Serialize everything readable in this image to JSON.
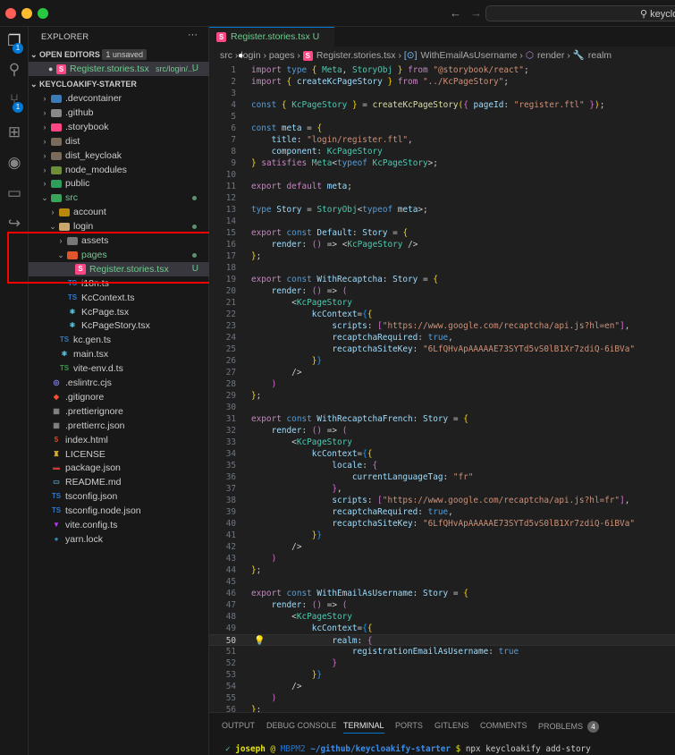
{
  "window": {
    "traffic_lights": [
      "#ff5f57",
      "#febc2e",
      "#28c840"
    ],
    "nav_back": "←",
    "nav_forward": "→",
    "search_text": "keyclo"
  },
  "activity": {
    "explorer_badge": "1",
    "scm_badge": "1"
  },
  "sidebar": {
    "title": "EXPLORER",
    "more": "···",
    "open_editors": {
      "label": "OPEN EDITORS",
      "badge": "1 unsaved",
      "file": "Register.stories.tsx",
      "path": "src/login/...",
      "status": "U"
    },
    "project": "KEYCLOAKIFY-STARTER",
    "tree": [
      {
        "name": ".devcontainer",
        "depth": 1,
        "type": "folder",
        "icon": "#3d7ab8"
      },
      {
        "name": ".github",
        "depth": 1,
        "type": "folder",
        "icon": "#888"
      },
      {
        "name": ".storybook",
        "depth": 1,
        "type": "folder",
        "icon": "#ff4785"
      },
      {
        "name": "dist",
        "depth": 1,
        "type": "folder",
        "icon": "#7a6b5a"
      },
      {
        "name": "dist_keycloak",
        "depth": 1,
        "type": "folder",
        "icon": "#7a6b5a"
      },
      {
        "name": "node_modules",
        "depth": 1,
        "type": "folder",
        "icon": "#6d8f3a"
      },
      {
        "name": "public",
        "depth": 1,
        "type": "folder",
        "icon": "#2e9e5a"
      },
      {
        "name": "src",
        "depth": 1,
        "type": "folder",
        "open": true,
        "icon": "#3aa55a",
        "green": true,
        "dot": true
      },
      {
        "name": "account",
        "depth": 2,
        "type": "folder",
        "icon": "#b8860b"
      },
      {
        "name": "login",
        "depth": 2,
        "type": "folder",
        "open": true,
        "icon": "#c9a66b",
        "dot": true
      },
      {
        "name": "assets",
        "depth": 3,
        "type": "folder",
        "icon": "#777"
      },
      {
        "name": "pages",
        "depth": 3,
        "type": "folder",
        "open": true,
        "icon": "#e0552b",
        "green": true,
        "dot": true
      },
      {
        "name": "Register.stories.tsx",
        "depth": 4,
        "type": "storybook",
        "selected": true,
        "green": true,
        "status": "U"
      },
      {
        "name": "i18n.ts",
        "depth": 3,
        "type": "ts"
      },
      {
        "name": "KcContext.ts",
        "depth": 3,
        "type": "ts"
      },
      {
        "name": "KcPage.tsx",
        "depth": 3,
        "type": "react"
      },
      {
        "name": "KcPageStory.tsx",
        "depth": 3,
        "type": "react"
      },
      {
        "name": "kc.gen.ts",
        "depth": 2,
        "type": "ts"
      },
      {
        "name": "main.tsx",
        "depth": 2,
        "type": "react"
      },
      {
        "name": "vite-env.d.ts",
        "depth": 2,
        "type": "tsd"
      },
      {
        "name": ".eslintrc.cjs",
        "depth": 1,
        "type": "eslint"
      },
      {
        "name": ".gitignore",
        "depth": 1,
        "type": "git"
      },
      {
        "name": ".prettierignore",
        "depth": 1,
        "type": "prettier"
      },
      {
        "name": ".prettierrc.json",
        "depth": 1,
        "type": "prettier"
      },
      {
        "name": "index.html",
        "depth": 1,
        "type": "html"
      },
      {
        "name": "LICENSE",
        "depth": 1,
        "type": "license"
      },
      {
        "name": "package.json",
        "depth": 1,
        "type": "npm"
      },
      {
        "name": "README.md",
        "depth": 1,
        "type": "md"
      },
      {
        "name": "tsconfig.json",
        "depth": 1,
        "type": "tsconfig"
      },
      {
        "name": "tsconfig.node.json",
        "depth": 1,
        "type": "tsconfig"
      },
      {
        "name": "vite.config.ts",
        "depth": 1,
        "type": "vite"
      },
      {
        "name": "yarn.lock",
        "depth": 1,
        "type": "yarn"
      }
    ]
  },
  "editor": {
    "tab": {
      "label": "Register.stories.tsx",
      "status": "U"
    },
    "breadcrumbs": [
      "src",
      "login",
      "pages",
      "Register.stories.tsx",
      "WithEmailAsUsername",
      "render",
      "realm"
    ],
    "current_line": 50,
    "lines": [
      "import type { Meta, StoryObj } from \"@storybook/react\";",
      "import { createKcPageStory } from \"../KcPageStory\";",
      "",
      "const { KcPageStory } = createKcPageStory({ pageId: \"register.ftl\" });",
      "",
      "const meta = {",
      "    title: \"login/register.ftl\",",
      "    component: KcPageStory",
      "} satisfies Meta<typeof KcPageStory>;",
      "",
      "export default meta;",
      "",
      "type Story = StoryObj<typeof meta>;",
      "",
      "export const Default: Story = {",
      "    render: () => <KcPageStory />",
      "};",
      "",
      "export const WithRecaptcha: Story = {",
      "    render: () => (",
      "        <KcPageStory",
      "            kcContext={{",
      "                scripts: [\"https://www.google.com/recaptcha/api.js?hl=en\"],",
      "                recaptchaRequired: true,",
      "                recaptchaSiteKey: \"6LfQHvApAAAAAE73SYTd5vS0lB1Xr7zdiQ-6iBVa\"",
      "            }}",
      "        />",
      "    )",
      "};",
      "",
      "export const WithRecaptchaFrench: Story = {",
      "    render: () => (",
      "        <KcPageStory",
      "            kcContext={{",
      "                locale: {",
      "                    currentLanguageTag: \"fr\"",
      "                },",
      "                scripts: [\"https://www.google.com/recaptcha/api.js?hl=fr\"],",
      "                recaptchaRequired: true,",
      "                recaptchaSiteKey: \"6LfQHvApAAAAAE73SYTd5vS0lB1Xr7zdiQ-6iBVa\"",
      "            }}",
      "        />",
      "    )",
      "};",
      "",
      "export const WithEmailAsUsername: Story = {",
      "    render: () => (",
      "        <KcPageStory",
      "            kcContext={{",
      "                realm: {",
      "                    registrationEmailAsUsername: true",
      "                }",
      "            }}",
      "        />",
      "    )",
      "};"
    ]
  },
  "panel": {
    "tabs": [
      {
        "label": "OUTPUT"
      },
      {
        "label": "DEBUG CONSOLE"
      },
      {
        "label": "TERMINAL",
        "active": true
      },
      {
        "label": "PORTS"
      },
      {
        "label": "GITLENS"
      },
      {
        "label": "COMMENTS"
      },
      {
        "label": "PROBLEMS",
        "badge": "4"
      }
    ],
    "terminal": {
      "check": "✓",
      "user": "joseph",
      "at": "@",
      "host": "MBPM2",
      "path": "~/github/keycloakify-starter",
      "prompt": "$",
      "command": "npx keycloakify add-story"
    }
  },
  "annotation": {
    "color": "#ff0000"
  }
}
